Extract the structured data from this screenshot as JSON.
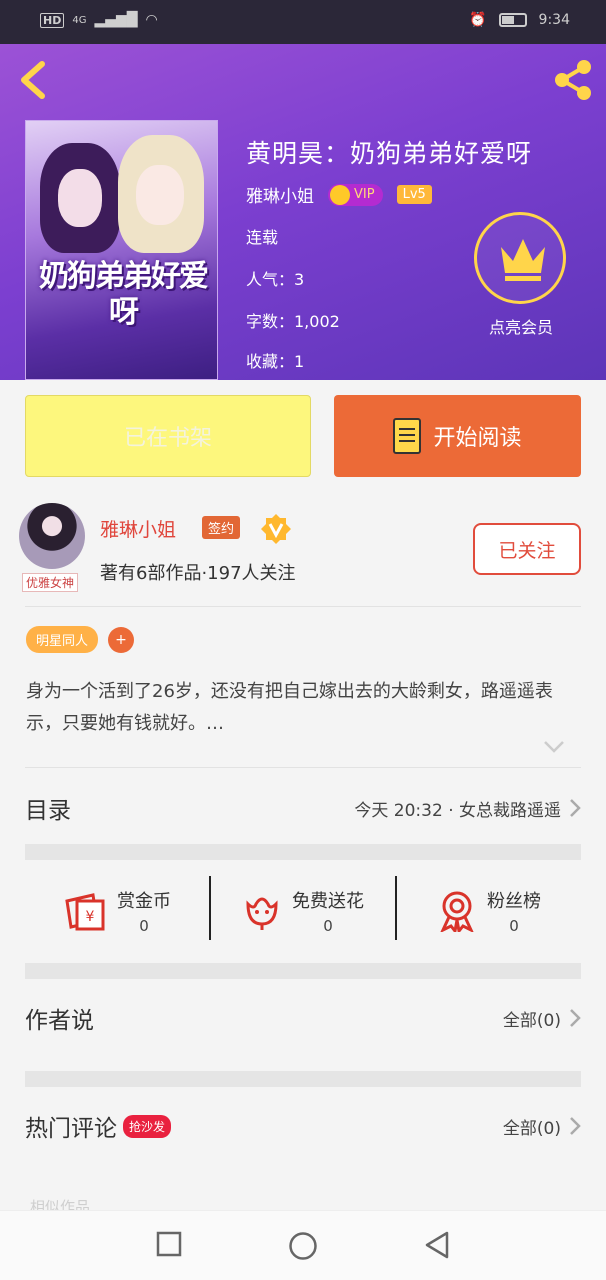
{
  "status_bar": {
    "network": "4G",
    "hd": "HD",
    "time": "9:34"
  },
  "book": {
    "title": "黄明昊：奶狗弟弟好爱呀",
    "cover_text": "奶狗弟弟好爱呀",
    "author": "雅琳小姐",
    "vip_label": "VIP",
    "level": "Lv5",
    "status": "连载",
    "popularity": "人气：3",
    "word_count": "字数：1,002",
    "favorites": "收藏：1"
  },
  "member": {
    "label": "点亮会员"
  },
  "actions": {
    "shelf_label": "已在书架",
    "read_label": "开始阅读"
  },
  "author_card": {
    "name": "雅琳小姐",
    "sign_badge": "签约",
    "avatar_tag": "优雅女神",
    "stats": "著有6部作品·197人关注",
    "follow_label": "已关注"
  },
  "tags": [
    "明星同人"
  ],
  "tag_add": "+",
  "summary": "身为一个活到了26岁，还没有把自己嫁出去的大龄剩女，路遥遥表示，只要她有钱就好。…",
  "catalog": {
    "title": "目录",
    "latest": "今天 20:32 · 女总裁路遥遥"
  },
  "stats": [
    {
      "label": "赏金币",
      "value": "0",
      "icon": "red-envelope-icon"
    },
    {
      "label": "免费送花",
      "value": "0",
      "icon": "flower-icon"
    },
    {
      "label": "粉丝榜",
      "value": "0",
      "icon": "medal-icon"
    }
  ],
  "author_says": {
    "title": "作者说",
    "all": "全部(0)"
  },
  "hot_comments": {
    "title": "热门评论",
    "badge": "抢沙发",
    "all": "全部(0)"
  },
  "related_hint": "相似作品",
  "colors": {
    "accent": "#ec6a37",
    "purple": "#7c3fd0",
    "gold": "#ffd54a",
    "red": "#e14c3c"
  }
}
